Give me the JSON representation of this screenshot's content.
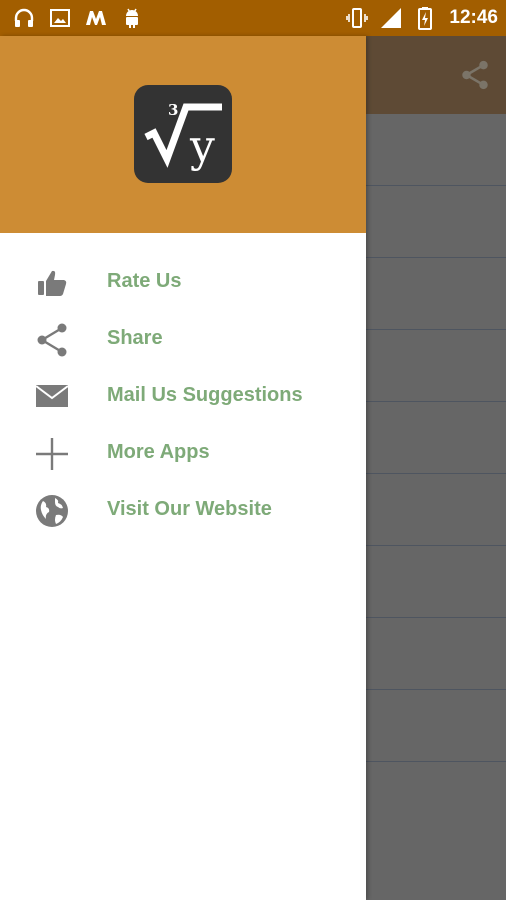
{
  "status_bar": {
    "time": "12:46",
    "left_icons": [
      "headphones-icon",
      "image-icon",
      "m-app-icon",
      "android-icon"
    ],
    "right_icons": [
      "vibrate-icon",
      "signal-icon",
      "battery-icon"
    ]
  },
  "colors": {
    "status_bar": "#a25e00",
    "drawer_header": "#cd8c34",
    "menu_text": "#7eaa78",
    "icon_gray": "#7a7a7a"
  },
  "drawer": {
    "logo": {
      "index": "3",
      "radicand": "y"
    },
    "items": [
      {
        "label": "Rate Us",
        "icon": "thumbs-up-icon"
      },
      {
        "label": "Share",
        "icon": "share-icon"
      },
      {
        "label": "Mail Us Suggestions",
        "icon": "mail-icon"
      },
      {
        "label": "More Apps",
        "icon": "plus-icon"
      },
      {
        "label": "Visit Our Website",
        "icon": "globe-icon"
      }
    ]
  }
}
